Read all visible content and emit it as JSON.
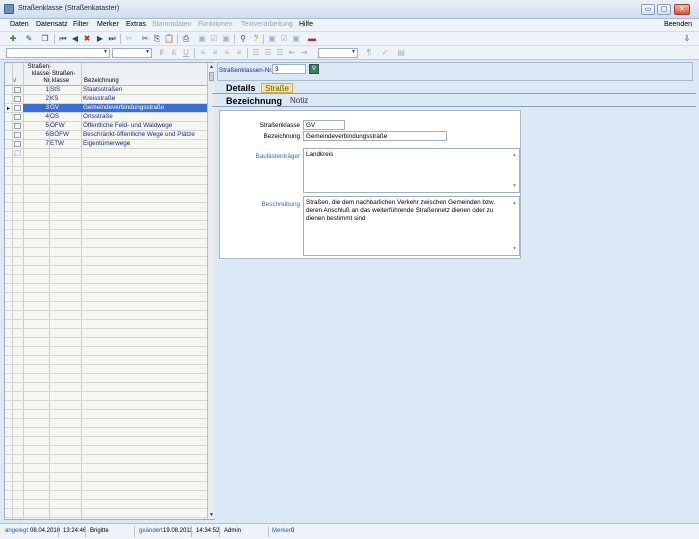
{
  "window": {
    "title": "Straßenklasse (Straßenkataster)",
    "min": "▭",
    "max": "▢",
    "close": "✕"
  },
  "menu": {
    "items": [
      {
        "label": "Daten",
        "disabled": false
      },
      {
        "label": "Datensatz",
        "disabled": false
      },
      {
        "label": "Filter",
        "disabled": false
      },
      {
        "label": "Merker",
        "disabled": false
      },
      {
        "label": "Extras",
        "disabled": false
      },
      {
        "label": "Stammdaten",
        "disabled": true
      },
      {
        "label": "Funktionen",
        "disabled": true
      },
      {
        "label": "Textverarbeitung",
        "disabled": true
      },
      {
        "label": "Hilfe",
        "disabled": false
      }
    ],
    "exit": "Beenden"
  },
  "toolbar2": {
    "bold": "F",
    "italic": "K",
    "underline": "U",
    "pilcrow": "¶"
  },
  "grid": {
    "headers": {
      "check": "√",
      "nr": "Straßen-\nklasse-\nNr.",
      "klasse": "Straßen-\nklasse",
      "bezeichnung": "Bezeichnung"
    },
    "rows": [
      {
        "nr": "1",
        "klasse": "StS",
        "bezeichnung": "Staatsstraßen",
        "selected": false
      },
      {
        "nr": "2",
        "klasse": "KS",
        "bezeichnung": "Kreisstraße",
        "selected": false
      },
      {
        "nr": "3",
        "klasse": "GV",
        "bezeichnung": "Gemeindeverbindungsstraße",
        "selected": true
      },
      {
        "nr": "4",
        "klasse": "OS",
        "bezeichnung": "Ortsstraße",
        "selected": false
      },
      {
        "nr": "5",
        "klasse": "ÖFW",
        "bezeichnung": "Öffentliche Feld- und Waldwege",
        "selected": false
      },
      {
        "nr": "6",
        "klasse": "BÖFW",
        "bezeichnung": "Beschränkt-öffentliche Wege und Plätze",
        "selected": false
      },
      {
        "nr": "7",
        "klasse": "ETW",
        "bezeichnung": "Eigentümerwege",
        "selected": false
      }
    ],
    "selected_marker": "▸"
  },
  "form": {
    "nr_label": "Straßenklassen-Nr.",
    "nr_value": "3",
    "tabs1": {
      "details": "Details",
      "strasse": "Straße"
    },
    "tabs2": {
      "bezeichnung": "Bezeichnung",
      "notiz": "Notiz"
    },
    "strassenklasse_label": "Straßenklasse",
    "strassenklasse_value": "GV",
    "bezeichnung_label": "Bezeichnung",
    "bezeichnung_value": "Gemeindeverbindungsstraße",
    "baulast_label": "Baulastenträger",
    "baulast_value": "Landkreis",
    "beschreibung_label": "Beschreibung",
    "beschreibung_value": "Straßen, die dem nachbarlichen Verkehr zwischen Gemeinden bzw. deren Anschluß an das weiterführende Straßennetz dienen oder zu dienen bestimmt sind"
  },
  "status": {
    "created_label": "angelegt",
    "created_date": "08.04.2010",
    "created_time": "13:24:46",
    "created_user": "Brigitte",
    "changed_label": "geändert",
    "changed_date": "19.08.2011",
    "changed_time": "14:34:52",
    "changed_user": "Admin",
    "merker_label": "Merker",
    "merker_value": "0"
  }
}
